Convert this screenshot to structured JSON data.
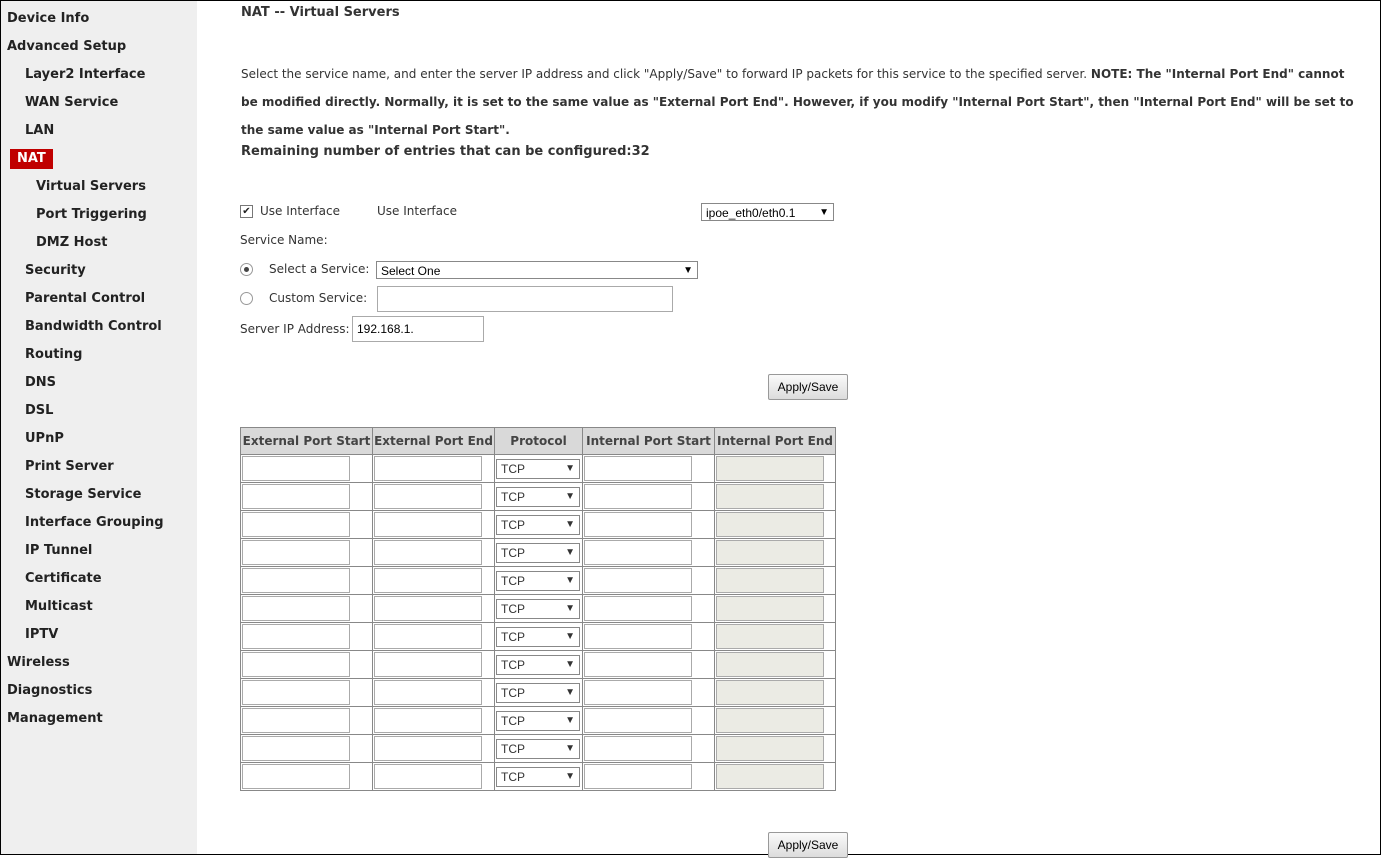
{
  "sidebar": {
    "items": [
      {
        "label": "Device Info",
        "level": 0
      },
      {
        "label": "Advanced Setup",
        "level": 0
      },
      {
        "label": "Layer2 Interface",
        "level": 1
      },
      {
        "label": "WAN Service",
        "level": 1
      },
      {
        "label": "LAN",
        "level": 1
      },
      {
        "label": "NAT",
        "level": 1,
        "active": true
      },
      {
        "label": "Virtual Servers",
        "level": 2
      },
      {
        "label": "Port Triggering",
        "level": 2
      },
      {
        "label": "DMZ Host",
        "level": 2
      },
      {
        "label": "Security",
        "level": 1
      },
      {
        "label": "Parental Control",
        "level": 1
      },
      {
        "label": "Bandwidth Control",
        "level": 1
      },
      {
        "label": "Routing",
        "level": 1
      },
      {
        "label": "DNS",
        "level": 1
      },
      {
        "label": "DSL",
        "level": 1
      },
      {
        "label": "UPnP",
        "level": 1
      },
      {
        "label": "Print Server",
        "level": 1
      },
      {
        "label": "Storage Service",
        "level": 1
      },
      {
        "label": "Interface Grouping",
        "level": 1
      },
      {
        "label": "IP Tunnel",
        "level": 1
      },
      {
        "label": "Certificate",
        "level": 1
      },
      {
        "label": "Multicast",
        "level": 1
      },
      {
        "label": "IPTV",
        "level": 1
      },
      {
        "label": "Wireless",
        "level": 0
      },
      {
        "label": "Diagnostics",
        "level": 0
      },
      {
        "label": "Management",
        "level": 0
      }
    ]
  },
  "main": {
    "title": "NAT -- Virtual Servers",
    "description_plain": "Select the service name, and enter the server IP address and click \"Apply/Save\" to forward IP packets for this service to the specified server. ",
    "description_note": "NOTE: The \"Internal Port End\" cannot be modified directly. Normally, it is set to the same value as \"External Port End\". However, if you modify \"Internal Port Start\", then \"Internal Port End\" will be set to the same value as \"Internal Port Start\".",
    "remaining_label": "Remaining number of entries that can be configured:",
    "remaining_value": "32",
    "use_interface": {
      "checked": true,
      "checkbox_label": "Use Interface",
      "label": "Use Interface",
      "selected": "ipoe_eth0/eth0.1"
    },
    "service_name_label": "Service Name:",
    "select_service": {
      "label": "Select a Service:",
      "selected": "Select One",
      "checked": true
    },
    "custom_service": {
      "label": "Custom Service:",
      "value": "",
      "checked": false
    },
    "server_ip": {
      "label": "Server IP Address:",
      "value": "192.168.1."
    },
    "apply_label": "Apply/Save",
    "table": {
      "headers": [
        "External Port Start",
        "External Port End",
        "Protocol",
        "Internal Port Start",
        "Internal Port End"
      ],
      "protocol_default": "TCP",
      "row_count": 12
    }
  }
}
